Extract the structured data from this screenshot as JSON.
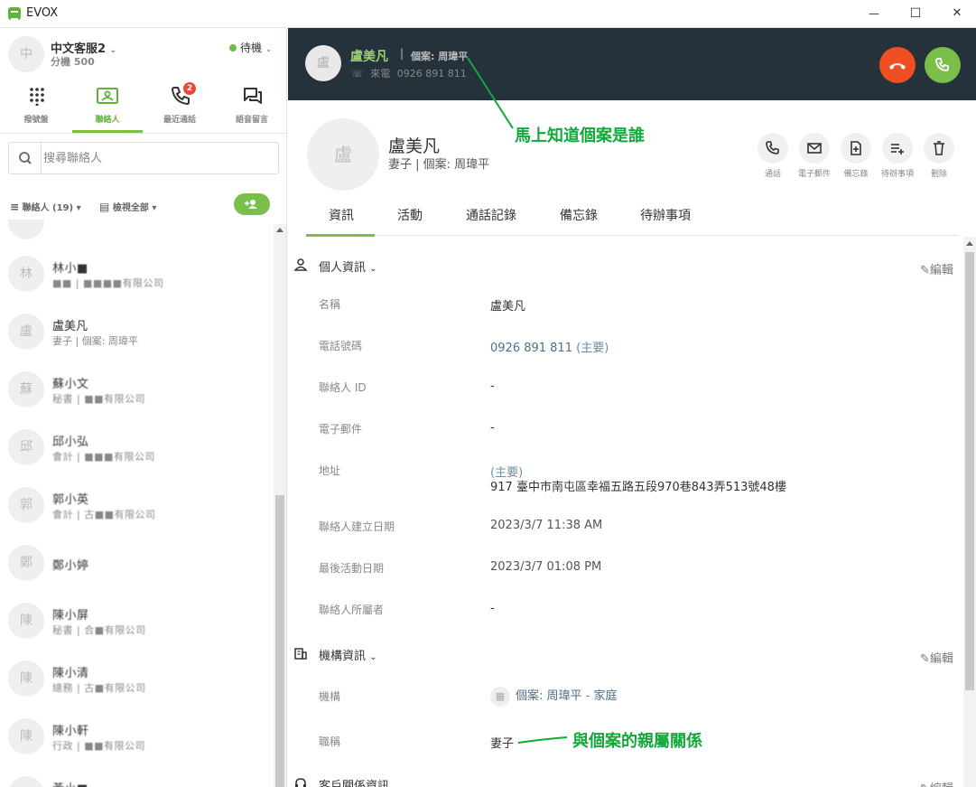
{
  "app": {
    "title": "EVOX"
  },
  "window": {
    "minimize": "—",
    "maximize": "☐",
    "close": "✕"
  },
  "agent": {
    "avatar": "中",
    "name": "中文客服2",
    "ext": "分機 500",
    "status": "待機"
  },
  "nav": [
    {
      "label": "撥號盤"
    },
    {
      "label": "聯絡人"
    },
    {
      "label": "最近通話",
      "badge": "2"
    },
    {
      "label": "語音留言"
    }
  ],
  "search": {
    "placeholder": "搜尋聯絡人"
  },
  "filters": {
    "contacts": "聯絡人 (19)",
    "view": "檢視全部"
  },
  "contacts": [
    {
      "avatar": "林",
      "name": "林小■",
      "sub": "■■ | ■■■■有限公司"
    },
    {
      "avatar": "盧",
      "name": "盧美凡",
      "sub": "妻子 | 個案: 周瑋平"
    },
    {
      "avatar": "蘇",
      "name": "蘇小文",
      "sub": "秘書 | ■■有限公司"
    },
    {
      "avatar": "邱",
      "name": "邱小弘",
      "sub": "會計 | ■■■有限公司"
    },
    {
      "avatar": "郭",
      "name": "郭小英",
      "sub": "會計 | 古■■有限公司"
    },
    {
      "avatar": "鄭",
      "name": "鄭小婷",
      "sub": ""
    },
    {
      "avatar": "陳",
      "name": "陳小屏",
      "sub": "秘書 | 合■有限公司"
    },
    {
      "avatar": "陳",
      "name": "陳小清",
      "sub": "總務 | 古■有限公司"
    },
    {
      "avatar": "陳",
      "name": "陳小軒",
      "sub": "行政 | ■■有限公司"
    },
    {
      "avatar": "",
      "name": "黃小■",
      "sub": ""
    }
  ],
  "call": {
    "avatar": "盧",
    "name": "盧美凡",
    "separator": "|",
    "case": "個案: 周瑋平",
    "direction": "來電",
    "number": "0926 891 811"
  },
  "profile": {
    "avatar": "盧",
    "name": "盧美凡",
    "sub": "妻子 | 個案: 周瑋平"
  },
  "actions": [
    {
      "label": "通話"
    },
    {
      "label": "電子郵件"
    },
    {
      "label": "備忘錄"
    },
    {
      "label": "待辦事項"
    },
    {
      "label": "刪除"
    }
  ],
  "tabs": [
    "資訊",
    "活動",
    "通話記錄",
    "備忘錄",
    "待辦事項"
  ],
  "sections": {
    "personal": {
      "title": "個人資訊",
      "edit": "編輯"
    },
    "org": {
      "title": "機構資訊",
      "edit": "編輯"
    },
    "crm": {
      "title": "客戶關係資訊",
      "edit": "編輯"
    }
  },
  "fields": {
    "name": {
      "label": "名稱",
      "value": "盧美凡"
    },
    "phone": {
      "label": "電話號碼",
      "value": "0926 891 811",
      "tag": "(主要)"
    },
    "contact_id": {
      "label": "聯絡人 ID",
      "value": "-"
    },
    "email": {
      "label": "電子郵件",
      "value": "-"
    },
    "address": {
      "label": "地址",
      "tag": "(主要)",
      "value": "917 臺中市南屯區幸福五路五段970巷843弄513號48樓"
    },
    "created": {
      "label": "聯絡人建立日期",
      "value": "2023/3/7 11:38 AM"
    },
    "last_activity": {
      "label": "最後活動日期",
      "value": "2023/3/7 01:08 PM"
    },
    "owner": {
      "label": "聯絡人所屬者",
      "value": "-"
    },
    "org": {
      "label": "機構",
      "value": "個案: 周瑋平 - 家庭"
    },
    "title": {
      "label": "職稱",
      "value": "妻子"
    }
  },
  "annotations": {
    "who": "馬上知道個案是誰",
    "relation": "與個案的親屬關係"
  },
  "colors": {
    "accent": "#7bbf4b",
    "header": "#25323b",
    "hangup": "#f04e23",
    "annotation": "#12a83a"
  }
}
